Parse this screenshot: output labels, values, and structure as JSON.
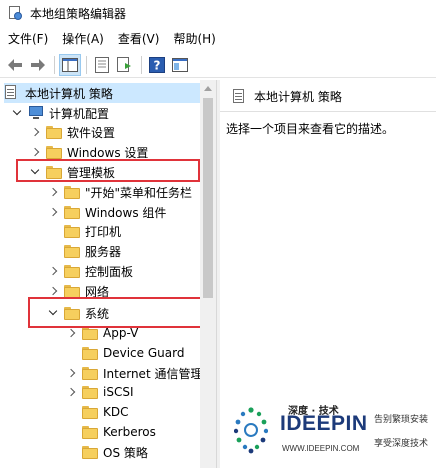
{
  "window": {
    "title": "本地组策略编辑器"
  },
  "menu": [
    "文件(F)",
    "操作(A)",
    "查看(V)",
    "帮助(H)"
  ],
  "toolbar": {
    "buttons": [
      "back-arrow-icon",
      "forward-arrow-icon",
      "show-hide-console-tree-icon",
      "properties-icon",
      "export-list-icon",
      "help-icon",
      "extended-view-icon"
    ]
  },
  "tree": {
    "root": "本地计算机 策略",
    "computer_config": "计算机配置",
    "software_settings": "软件设置",
    "windows_settings": "Windows 设置",
    "admin_templates": "管理模板",
    "start_menu": "\"开始\"菜单和任务栏",
    "windows_components": "Windows 组件",
    "printers": "打印机",
    "servers": "服务器",
    "control_panel": "控制面板",
    "network": "网络",
    "system": "系统",
    "app_v": "App-V",
    "device_guard": "Device Guard",
    "internet_comm": "Internet 通信管理",
    "iscsi": "iSCSI",
    "kdc": "KDC",
    "kerberos": "Kerberos",
    "os_policy": "OS 策略"
  },
  "right_pane": {
    "header": "本地计算机 策略",
    "description": "选择一个项目来查看它的描述。"
  },
  "watermark": {
    "small": "深度 · 技术",
    "big": "IDEEPIN",
    "url": "WWW.IDEEPIN.COM",
    "slogan1": "告别繁琐安装",
    "slogan2": "享受深度技术"
  },
  "colors": {
    "highlight_box": "#e0333a",
    "selection": "#cce8ff",
    "folder": "#f6cf5e"
  }
}
